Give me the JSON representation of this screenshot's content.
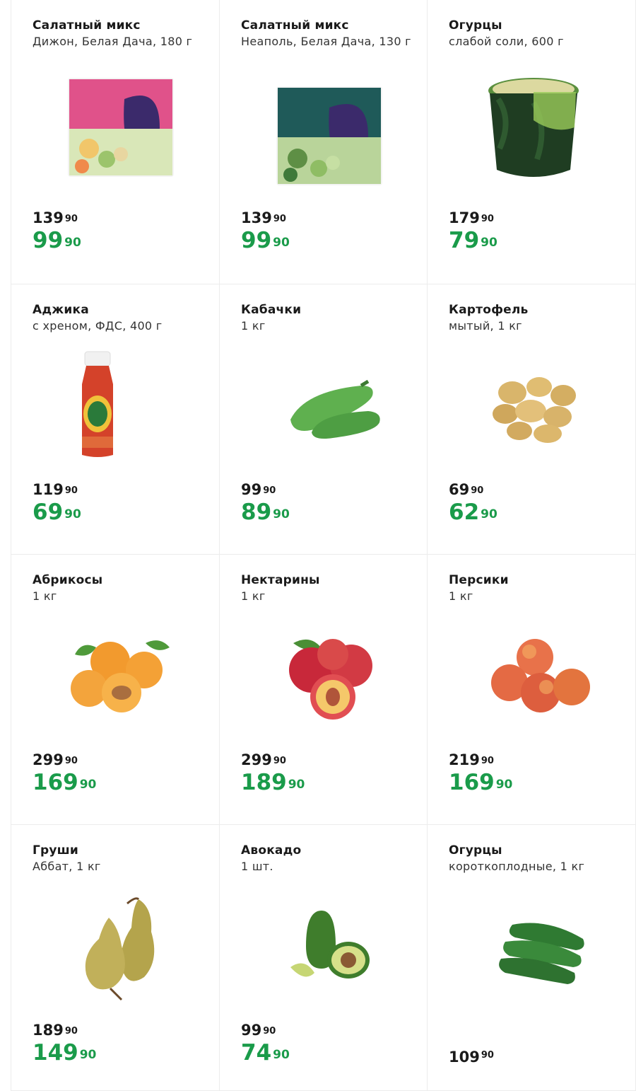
{
  "colors": {
    "accent_price": "#1a9b4a",
    "text": "#1a1a1a",
    "border": "#ececec"
  },
  "products": [
    {
      "title": "Салатный микс",
      "subtitle": "Дижон, Белая Дача, 180 г",
      "old_main": "139",
      "old_cents": "90",
      "new_main": "99",
      "new_cents": "90",
      "image": "salad-bag-pink-icon"
    },
    {
      "title": "Салатный микс",
      "subtitle": "Неаполь, Белая Дача, 130 г",
      "old_main": "139",
      "old_cents": "90",
      "new_main": "99",
      "new_cents": "90",
      "image": "salad-bag-green-icon"
    },
    {
      "title": "Огурцы",
      "subtitle": "слабой соли, 600 г",
      "old_main": "179",
      "old_cents": "90",
      "new_main": "79",
      "new_cents": "90",
      "image": "pickle-jar-icon"
    },
    {
      "title": "Аджика",
      "subtitle": "с хреном, ФДС, 400 г",
      "old_main": "119",
      "old_cents": "90",
      "new_main": "69",
      "new_cents": "90",
      "image": "adjika-bottle-icon"
    },
    {
      "title": "Кабачки",
      "subtitle": "1 кг",
      "old_main": "99",
      "old_cents": "90",
      "new_main": "89",
      "new_cents": "90",
      "image": "zucchini-icon"
    },
    {
      "title": "Картофель",
      "subtitle": "мытый, 1 кг",
      "old_main": "69",
      "old_cents": "90",
      "new_main": "62",
      "new_cents": "90",
      "image": "potatoes-icon"
    },
    {
      "title": "Абрикосы",
      "subtitle": "1 кг",
      "old_main": "299",
      "old_cents": "90",
      "new_main": "169",
      "new_cents": "90",
      "image": "apricots-icon"
    },
    {
      "title": "Нектарины",
      "subtitle": "1 кг",
      "old_main": "299",
      "old_cents": "90",
      "new_main": "189",
      "new_cents": "90",
      "image": "nectarines-icon"
    },
    {
      "title": "Персики",
      "subtitle": "1 кг",
      "old_main": "219",
      "old_cents": "90",
      "new_main": "169",
      "new_cents": "90",
      "image": "peaches-icon"
    },
    {
      "title": "Груши",
      "subtitle": "Аббат, 1 кг",
      "old_main": "189",
      "old_cents": "90",
      "new_main": "149",
      "new_cents": "90",
      "image": "pears-icon"
    },
    {
      "title": "Авокадо",
      "subtitle": "1 шт.",
      "old_main": "99",
      "old_cents": "90",
      "new_main": "74",
      "new_cents": "90",
      "image": "avocado-icon"
    },
    {
      "title": "Огурцы",
      "subtitle": "короткоплодные, 1 кг",
      "old_main": "109",
      "old_cents": "90",
      "image": "cucumbers-icon"
    }
  ]
}
